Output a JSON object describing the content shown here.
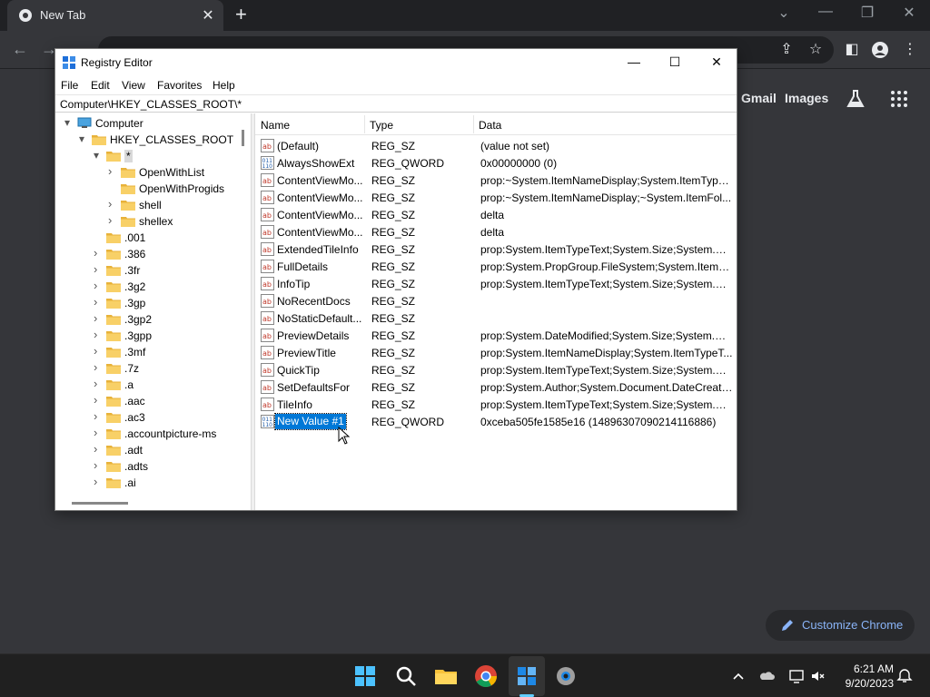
{
  "browser": {
    "tab_title": "New Tab",
    "links": {
      "gmail": "Gmail",
      "images": "Images"
    },
    "customize_label": "Customize Chrome"
  },
  "regedit": {
    "title": "Registry Editor",
    "menu": [
      "File",
      "Edit",
      "View",
      "Favorites",
      "Help"
    ],
    "address": "Computer\\HKEY_CLASSES_ROOT\\*",
    "tree": [
      {
        "label": "Computer",
        "depth": 0,
        "arrow": "open",
        "kind": "computer"
      },
      {
        "label": "HKEY_CLASSES_ROOT",
        "depth": 1,
        "arrow": "open",
        "kind": "folder"
      },
      {
        "label": "*",
        "depth": 2,
        "arrow": "open",
        "kind": "folder",
        "selected": true
      },
      {
        "label": "OpenWithList",
        "depth": 3,
        "arrow": "closed",
        "kind": "folder"
      },
      {
        "label": "OpenWithProgids",
        "depth": 3,
        "arrow": "none",
        "kind": "folder"
      },
      {
        "label": "shell",
        "depth": 3,
        "arrow": "closed",
        "kind": "folder"
      },
      {
        "label": "shellex",
        "depth": 3,
        "arrow": "closed",
        "kind": "folder"
      },
      {
        "label": ".001",
        "depth": 2,
        "arrow": "none",
        "kind": "folder"
      },
      {
        "label": ".386",
        "depth": 2,
        "arrow": "closed",
        "kind": "folder"
      },
      {
        "label": ".3fr",
        "depth": 2,
        "arrow": "closed",
        "kind": "folder"
      },
      {
        "label": ".3g2",
        "depth": 2,
        "arrow": "closed",
        "kind": "folder"
      },
      {
        "label": ".3gp",
        "depth": 2,
        "arrow": "closed",
        "kind": "folder"
      },
      {
        "label": ".3gp2",
        "depth": 2,
        "arrow": "closed",
        "kind": "folder"
      },
      {
        "label": ".3gpp",
        "depth": 2,
        "arrow": "closed",
        "kind": "folder"
      },
      {
        "label": ".3mf",
        "depth": 2,
        "arrow": "closed",
        "kind": "folder"
      },
      {
        "label": ".7z",
        "depth": 2,
        "arrow": "closed",
        "kind": "folder"
      },
      {
        "label": ".a",
        "depth": 2,
        "arrow": "closed",
        "kind": "folder"
      },
      {
        "label": ".aac",
        "depth": 2,
        "arrow": "closed",
        "kind": "folder"
      },
      {
        "label": ".ac3",
        "depth": 2,
        "arrow": "closed",
        "kind": "folder"
      },
      {
        "label": ".accountpicture-ms",
        "depth": 2,
        "arrow": "closed",
        "kind": "folder"
      },
      {
        "label": ".adt",
        "depth": 2,
        "arrow": "closed",
        "kind": "folder"
      },
      {
        "label": ".adts",
        "depth": 2,
        "arrow": "closed",
        "kind": "folder"
      },
      {
        "label": ".ai",
        "depth": 2,
        "arrow": "closed",
        "kind": "folder"
      }
    ],
    "columns": [
      "Name",
      "Type",
      "Data"
    ],
    "values": [
      {
        "name": "(Default)",
        "type": "REG_SZ",
        "data": "(value not set)",
        "icon": "string"
      },
      {
        "name": "AlwaysShowExt",
        "type": "REG_QWORD",
        "data": "0x00000000 (0)",
        "icon": "binary"
      },
      {
        "name": "ContentViewMo...",
        "type": "REG_SZ",
        "data": "prop:~System.ItemNameDisplay;System.ItemType...",
        "icon": "string"
      },
      {
        "name": "ContentViewMo...",
        "type": "REG_SZ",
        "data": "prop:~System.ItemNameDisplay;~System.ItemFol...",
        "icon": "string"
      },
      {
        "name": "ContentViewMo...",
        "type": "REG_SZ",
        "data": "delta",
        "icon": "string"
      },
      {
        "name": "ContentViewMo...",
        "type": "REG_SZ",
        "data": "delta",
        "icon": "string"
      },
      {
        "name": "ExtendedTileInfo",
        "type": "REG_SZ",
        "data": "prop:System.ItemTypeText;System.Size;System.Dat...",
        "icon": "string"
      },
      {
        "name": "FullDetails",
        "type": "REG_SZ",
        "data": "prop:System.PropGroup.FileSystem;System.ItemN...",
        "icon": "string"
      },
      {
        "name": "InfoTip",
        "type": "REG_SZ",
        "data": "prop:System.ItemTypeText;System.Size;System.Dat...",
        "icon": "string"
      },
      {
        "name": "NoRecentDocs",
        "type": "REG_SZ",
        "data": "",
        "icon": "string"
      },
      {
        "name": "NoStaticDefault...",
        "type": "REG_SZ",
        "data": "",
        "icon": "string"
      },
      {
        "name": "PreviewDetails",
        "type": "REG_SZ",
        "data": "prop:System.DateModified;System.Size;System.Dat...",
        "icon": "string"
      },
      {
        "name": "PreviewTitle",
        "type": "REG_SZ",
        "data": "prop:System.ItemNameDisplay;System.ItemTypeT...",
        "icon": "string"
      },
      {
        "name": "QuickTip",
        "type": "REG_SZ",
        "data": "prop:System.ItemTypeText;System.Size;System.Dat...",
        "icon": "string"
      },
      {
        "name": "SetDefaultsFor",
        "type": "REG_SZ",
        "data": "prop:System.Author;System.Document.DateCreated",
        "icon": "string"
      },
      {
        "name": "TileInfo",
        "type": "REG_SZ",
        "data": "prop:System.ItemTypeText;System.Size;System.Dat...",
        "icon": "string"
      },
      {
        "name": "New Value #1",
        "type": "REG_QWORD",
        "data": "0xceba505fe1585e16 (14896307090214116886)",
        "icon": "binary",
        "editing": true
      }
    ]
  },
  "taskbar": {
    "time": "6:21 AM",
    "date": "9/20/2023"
  }
}
